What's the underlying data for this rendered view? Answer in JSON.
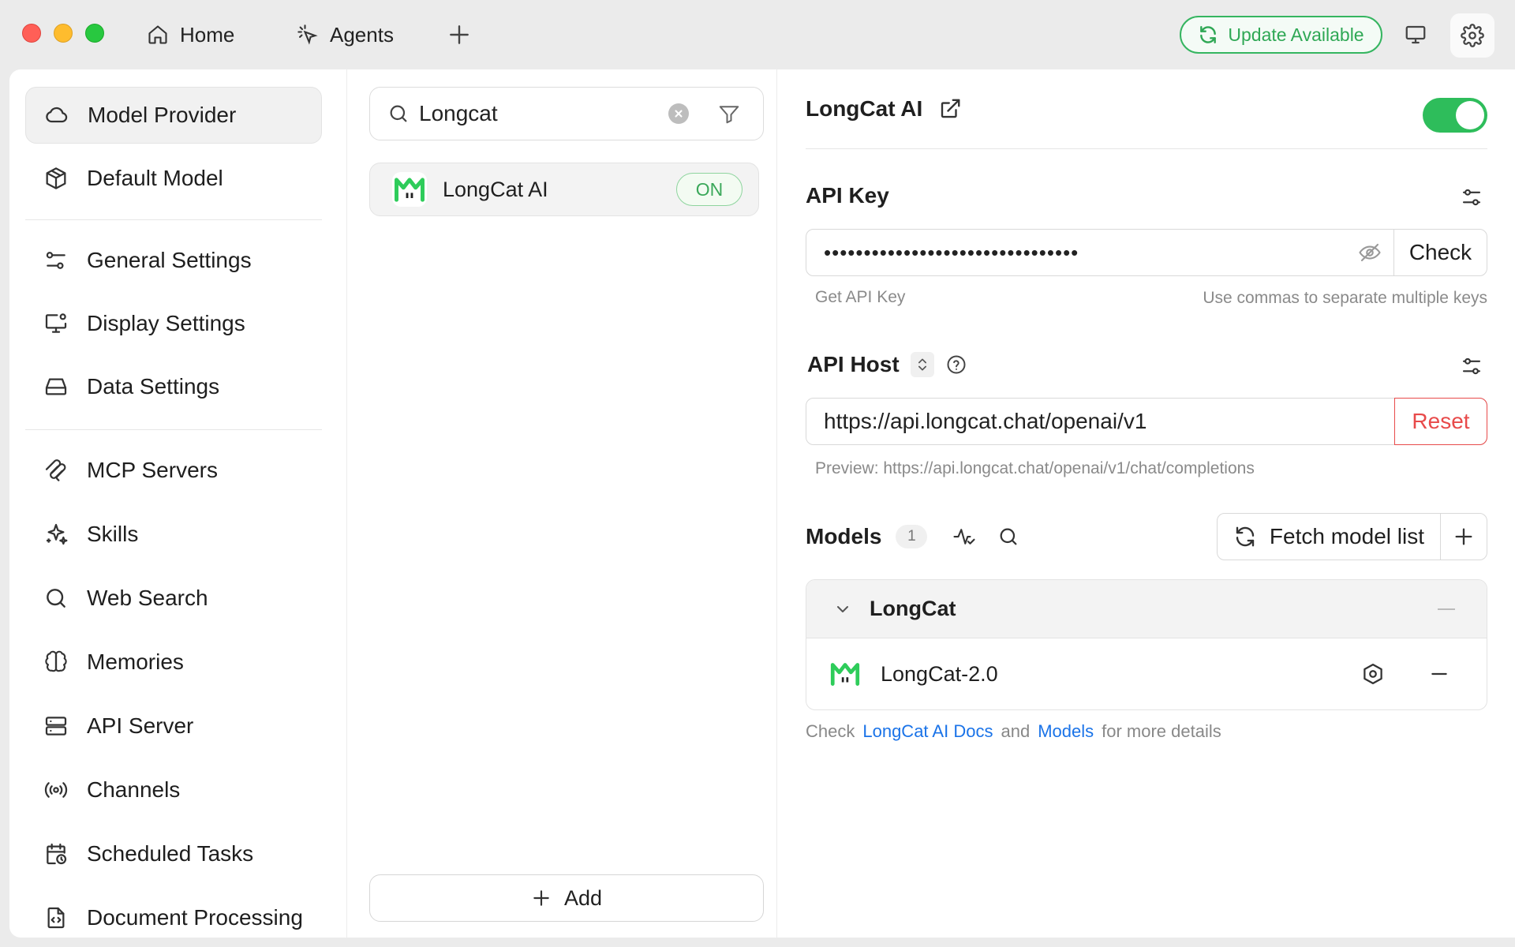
{
  "titlebar": {
    "tabs": [
      {
        "label": "Home",
        "icon": "home-icon"
      },
      {
        "label": "Agents",
        "icon": "agents-icon"
      }
    ],
    "update_label": "Update Available",
    "colors": {
      "update_accent": "#2fa855"
    }
  },
  "sidebar": {
    "items": [
      {
        "label": "Model Provider",
        "icon": "cloud-icon",
        "active": true
      },
      {
        "label": "Default Model",
        "icon": "cube-icon"
      },
      {
        "label": "General Settings",
        "icon": "sliders-icon"
      },
      {
        "label": "Display Settings",
        "icon": "monitor-settings-icon"
      },
      {
        "label": "Data Settings",
        "icon": "hard-drive-icon"
      },
      {
        "label": "MCP Servers",
        "icon": "mcp-icon"
      },
      {
        "label": "Skills",
        "icon": "sparkles-icon"
      },
      {
        "label": "Web Search",
        "icon": "search-icon"
      },
      {
        "label": "Memories",
        "icon": "brain-icon"
      },
      {
        "label": "API Server",
        "icon": "server-icon"
      },
      {
        "label": "Channels",
        "icon": "broadcast-icon"
      },
      {
        "label": "Scheduled Tasks",
        "icon": "calendar-clock-icon"
      },
      {
        "label": "Document Processing",
        "icon": "file-code-icon"
      }
    ]
  },
  "providers": {
    "search_value": "Longcat",
    "list": [
      {
        "name": "LongCat AI",
        "status": "ON"
      }
    ],
    "add_label": "Add"
  },
  "detail": {
    "provider_name": "LongCat AI",
    "enabled": true,
    "api_key": {
      "label": "API Key",
      "value": "••••••••••••••••••••••••••••••••",
      "check_label": "Check",
      "get_key_label": "Get API Key",
      "hint": "Use commas to separate multiple keys"
    },
    "api_host": {
      "label": "API Host",
      "value": "https://api.longcat.chat/openai/v1",
      "reset_label": "Reset",
      "preview": "Preview: https://api.longcat.chat/openai/v1/chat/completions"
    },
    "models": {
      "label": "Models",
      "count": "1",
      "fetch_label": "Fetch model list",
      "group_name": "LongCat",
      "items": [
        {
          "name": "LongCat-2.0"
        }
      ]
    },
    "footer": {
      "prefix": "Check",
      "docs_link": "LongCat AI Docs",
      "and": "and",
      "models_link": "Models",
      "suffix": "for more details"
    },
    "colors": {
      "toggle_on": "#2ebd5b",
      "link": "#1a73e8",
      "reset": "#e84a4a"
    }
  }
}
